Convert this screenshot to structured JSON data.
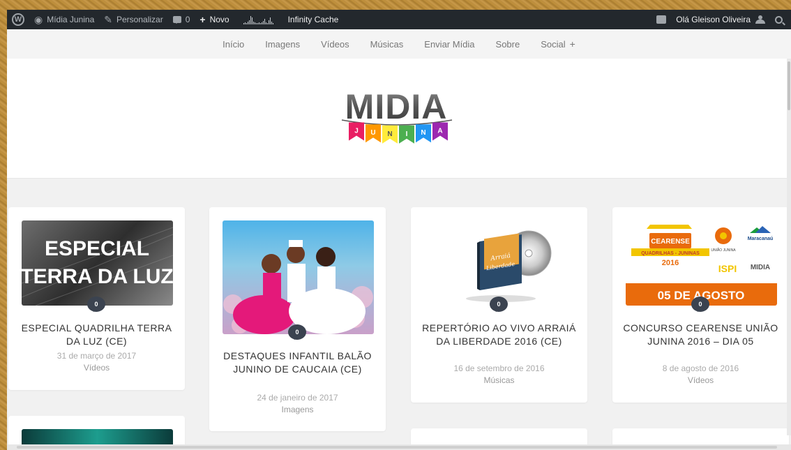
{
  "adminbar": {
    "site_name": "Mídia Junina",
    "customize": "Personalizar",
    "comments_count": "0",
    "new_label": "Novo",
    "cache_label": "Infinity Cache",
    "greeting": "Olá Gleison Oliveira"
  },
  "nav": {
    "items": [
      "Início",
      "Imagens",
      "Vídeos",
      "Músicas",
      "Enviar Mídia",
      "Sobre",
      "Social"
    ],
    "plus": "+"
  },
  "logo": {
    "title": "MIDIA",
    "letters": [
      "J",
      "U",
      "N",
      "I",
      "N",
      "A"
    ],
    "colors": [
      "#e91e63",
      "#ff9800",
      "#ffeb3b",
      "#4caf50",
      "#2196f3",
      "#9c27b0"
    ]
  },
  "cards": [
    {
      "thumb_text": [
        "ESPECIAL",
        "TERRA DA LUZ"
      ],
      "comments": "0",
      "title": "ESPECIAL QUADRILHA TERRA DA LUZ (CE)",
      "date": "31 de março de 2017",
      "category": "Vídeos"
    },
    {
      "comments": "0",
      "title": "DESTAQUES INFANTIL BALÃO JUNINO DE CAUCAIA (CE)",
      "date": "24 de janeiro de 2017",
      "category": "Imagens"
    },
    {
      "thumb_text": [
        "Arraiá",
        "Liberdade"
      ],
      "comments": "0",
      "title": "REPERTÓRIO AO VIVO ARRAIÁ DA LIBERDADE 2016 (CE)",
      "date": "16 de setembro de 2016",
      "category": "Músicas"
    },
    {
      "thumb_text": [
        "CEARENSE",
        "QUADRILHAS - JUNINAS",
        "2016",
        "UNIÃO JUNINA",
        "Maracanaú",
        "ISPI",
        "MIDIA",
        "05 DE AGOSTO"
      ],
      "comments": "0",
      "title": "CONCURSO CEARENSE UNIÃO JUNINA 2016 – DIA 05",
      "date": "8 de agosto de 2016",
      "category": "Vídeos"
    }
  ],
  "colors": {
    "adminbar_bg": "#23282d",
    "bubble_bg": "#3b4350",
    "orange_banner": "#e96b0c"
  }
}
